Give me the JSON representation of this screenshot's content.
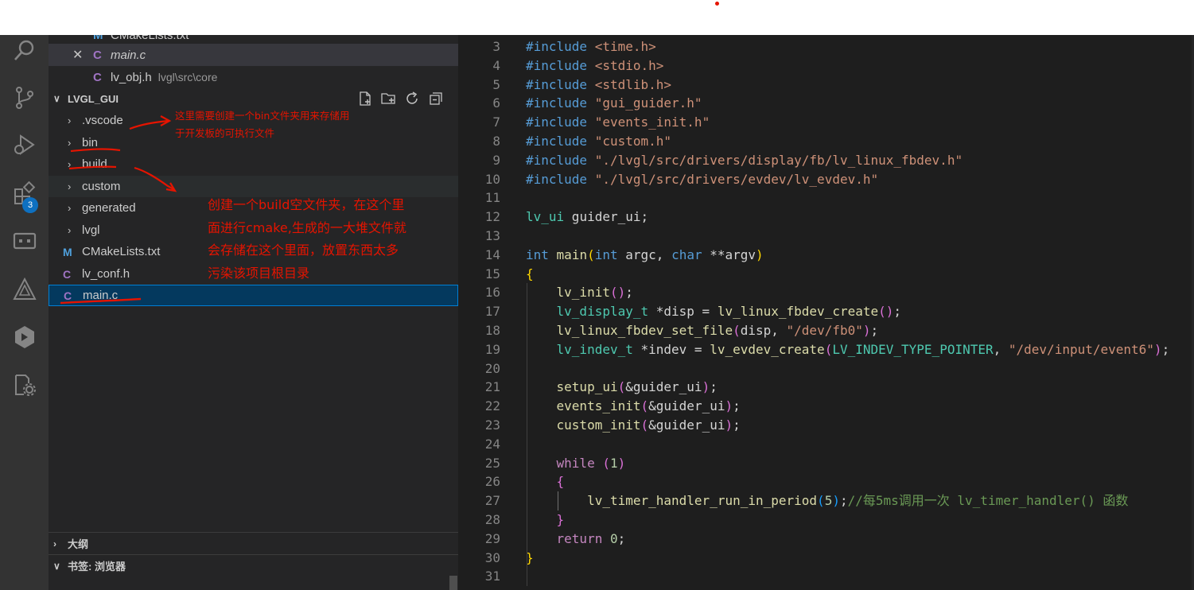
{
  "colors": {
    "keyword": "#569cd6",
    "control": "#c586c0",
    "function": "#dcdcaa",
    "type": "#4ec9b0",
    "string": "#ce9178",
    "number": "#b5cea8",
    "comment": "#6a9955",
    "variable": "#9cdcfe",
    "bracket1": "#ffd700",
    "bracket2": "#da70d6",
    "bracket3": "#179fff",
    "plain": "#d4d4d4",
    "annotation": "#e51400"
  },
  "activity_icons": [
    "search-icon",
    "source-control-icon",
    "run-debug-icon",
    "extensions-icon",
    "remote-explorer-icon",
    "azure-icon",
    "cmake-icon",
    "container-settings-icon"
  ],
  "extensions_badge": "3",
  "open_editors": [
    {
      "tag": "M",
      "name": "CMakeLists.txt",
      "desc": ""
    },
    {
      "tag": "C",
      "name": "main.c",
      "desc": "",
      "close": "✕"
    },
    {
      "tag": "C",
      "name": "lv_obj.h",
      "desc": "lvgl\\src\\core"
    }
  ],
  "explorer": {
    "root": "LVGL_GUI",
    "tree": [
      {
        "kind": "folder",
        "name": ".vscode"
      },
      {
        "kind": "folder",
        "name": "bin"
      },
      {
        "kind": "folder",
        "name": "build"
      },
      {
        "kind": "folder",
        "name": "custom"
      },
      {
        "kind": "folder",
        "name": "generated"
      },
      {
        "kind": "folder",
        "name": "lvgl"
      },
      {
        "kind": "file",
        "tag": "M",
        "name": "CMakeLists.txt"
      },
      {
        "kind": "file",
        "tag": "C",
        "name": "lv_conf.h"
      },
      {
        "kind": "file",
        "tag": "C",
        "name": "main.c"
      }
    ]
  },
  "panels": {
    "outline": "大纲",
    "bookmarks": "书签: 浏览器"
  },
  "annotations": {
    "note1": [
      "这里需要创建一个bin文件夹用来存储用",
      "于开发板的可执行文件"
    ],
    "note2": [
      "创建一个build空文件夹，在这个里",
      "面进行cmake,生成的一大堆文件就",
      "会存储在这个里面，放置东西太多",
      "污染该项目根目录"
    ]
  },
  "code_lines": [
    {
      "n": 3,
      "t": [
        [
          "#include ",
          "keyword"
        ],
        [
          "<time.h>",
          "string"
        ]
      ]
    },
    {
      "n": 4,
      "t": [
        [
          "#include ",
          "keyword"
        ],
        [
          "<stdio.h>",
          "string"
        ]
      ]
    },
    {
      "n": 5,
      "t": [
        [
          "#include ",
          "keyword"
        ],
        [
          "<stdlib.h>",
          "string"
        ]
      ]
    },
    {
      "n": 6,
      "t": [
        [
          "#include ",
          "keyword"
        ],
        [
          "\"gui_guider.h\"",
          "string"
        ]
      ]
    },
    {
      "n": 7,
      "t": [
        [
          "#include ",
          "keyword"
        ],
        [
          "\"events_init.h\"",
          "string"
        ]
      ]
    },
    {
      "n": 8,
      "t": [
        [
          "#include ",
          "keyword"
        ],
        [
          "\"custom.h\"",
          "string"
        ]
      ]
    },
    {
      "n": 9,
      "t": [
        [
          "#include ",
          "keyword"
        ],
        [
          "\"./lvgl/src/drivers/display/fb/lv_linux_fbdev.h\"",
          "string"
        ]
      ]
    },
    {
      "n": 10,
      "t": [
        [
          "#include ",
          "keyword"
        ],
        [
          "\"./lvgl/src/drivers/evdev/lv_evdev.h\"",
          "string"
        ]
      ]
    },
    {
      "n": 11,
      "t": []
    },
    {
      "n": 12,
      "t": [
        [
          "lv_ui",
          "type"
        ],
        [
          " guider_ui;",
          "plain"
        ]
      ]
    },
    {
      "n": 13,
      "t": []
    },
    {
      "n": 14,
      "t": [
        [
          "int",
          "keyword"
        ],
        [
          " ",
          "plain"
        ],
        [
          "main",
          "function"
        ],
        [
          "(",
          "bracket1"
        ],
        [
          "int",
          "keyword"
        ],
        [
          " argc, ",
          "plain"
        ],
        [
          "char",
          "keyword"
        ],
        [
          " **argv",
          "plain"
        ],
        [
          ")",
          "bracket1"
        ]
      ]
    },
    {
      "n": 15,
      "t": [
        [
          "{",
          "bracket1"
        ]
      ]
    },
    {
      "n": 16,
      "t": [
        [
          "    ",
          "plain"
        ],
        [
          "lv_init",
          "function"
        ],
        [
          "()",
          "bracket2"
        ],
        [
          ";",
          "plain"
        ]
      ]
    },
    {
      "n": 17,
      "t": [
        [
          "    ",
          "plain"
        ],
        [
          "lv_display_t",
          "type"
        ],
        [
          " *disp = ",
          "plain"
        ],
        [
          "lv_linux_fbdev_create",
          "function"
        ],
        [
          "()",
          "bracket2"
        ],
        [
          ";",
          "plain"
        ]
      ]
    },
    {
      "n": 18,
      "t": [
        [
          "    ",
          "plain"
        ],
        [
          "lv_linux_fbdev_set_file",
          "function"
        ],
        [
          "(",
          "bracket2"
        ],
        [
          "disp, ",
          "plain"
        ],
        [
          "\"/dev/fb0\"",
          "string"
        ],
        [
          ")",
          "bracket2"
        ],
        [
          ";",
          "plain"
        ]
      ]
    },
    {
      "n": 19,
      "t": [
        [
          "    ",
          "plain"
        ],
        [
          "lv_indev_t",
          "type"
        ],
        [
          " *indev = ",
          "plain"
        ],
        [
          "lv_evdev_create",
          "function"
        ],
        [
          "(",
          "bracket2"
        ],
        [
          "LV_INDEV_TYPE_POINTER",
          "type"
        ],
        [
          ", ",
          "plain"
        ],
        [
          "\"/dev/input/event6\"",
          "string"
        ],
        [
          ")",
          "bracket2"
        ],
        [
          ";",
          "plain"
        ]
      ]
    },
    {
      "n": 20,
      "t": []
    },
    {
      "n": 21,
      "t": [
        [
          "    ",
          "plain"
        ],
        [
          "setup_ui",
          "function"
        ],
        [
          "(",
          "bracket2"
        ],
        [
          "&guider_ui",
          "plain"
        ],
        [
          ")",
          "bracket2"
        ],
        [
          ";",
          "plain"
        ]
      ]
    },
    {
      "n": 22,
      "t": [
        [
          "    ",
          "plain"
        ],
        [
          "events_init",
          "function"
        ],
        [
          "(",
          "bracket2"
        ],
        [
          "&guider_ui",
          "plain"
        ],
        [
          ")",
          "bracket2"
        ],
        [
          ";",
          "plain"
        ]
      ]
    },
    {
      "n": 23,
      "t": [
        [
          "    ",
          "plain"
        ],
        [
          "custom_init",
          "function"
        ],
        [
          "(",
          "bracket2"
        ],
        [
          "&guider_ui",
          "plain"
        ],
        [
          ")",
          "bracket2"
        ],
        [
          ";",
          "plain"
        ]
      ]
    },
    {
      "n": 24,
      "t": []
    },
    {
      "n": 25,
      "t": [
        [
          "    ",
          "plain"
        ],
        [
          "while",
          "control"
        ],
        [
          " ",
          "plain"
        ],
        [
          "(",
          "bracket2"
        ],
        [
          "1",
          "number"
        ],
        [
          ")",
          "bracket2"
        ]
      ]
    },
    {
      "n": 26,
      "t": [
        [
          "    ",
          "plain"
        ],
        [
          "{",
          "bracket2"
        ]
      ]
    },
    {
      "n": 27,
      "t": [
        [
          "        ",
          "plain"
        ],
        [
          "lv_timer_handler_run_in_period",
          "function"
        ],
        [
          "(",
          "bracket3"
        ],
        [
          "5",
          "number"
        ],
        [
          ")",
          "bracket3"
        ],
        [
          ";",
          "plain"
        ],
        [
          "//每5ms调用一次 lv_timer_handler() 函数",
          "comment"
        ]
      ]
    },
    {
      "n": 28,
      "t": [
        [
          "    ",
          "plain"
        ],
        [
          "}",
          "bracket2"
        ]
      ]
    },
    {
      "n": 29,
      "t": [
        [
          "    ",
          "plain"
        ],
        [
          "return",
          "control"
        ],
        [
          " ",
          "plain"
        ],
        [
          "0",
          "number"
        ],
        [
          ";",
          "plain"
        ]
      ]
    },
    {
      "n": 30,
      "t": [
        [
          "}",
          "bracket1"
        ]
      ]
    },
    {
      "n": 31,
      "t": []
    }
  ]
}
